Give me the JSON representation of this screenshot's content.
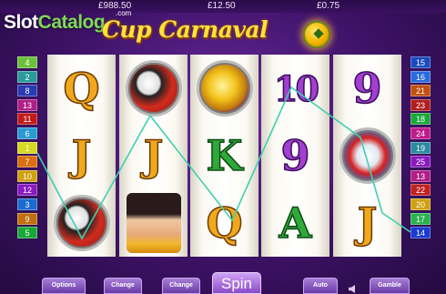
{
  "header": {
    "values": [
      "£988.50",
      "£12.50",
      "£0.75"
    ]
  },
  "watermark": {
    "text_a": "Slot",
    "text_b": "Catalog",
    "suffix": ".com"
  },
  "logo": {
    "text": "Cup Carnaval",
    "ball_icon": "football-icon"
  },
  "paylines_left": [
    {
      "n": "4",
      "color": "#6bbf3a"
    },
    {
      "n": "2",
      "color": "#2a9a9a"
    },
    {
      "n": "8",
      "color": "#2a3ab0"
    },
    {
      "n": "13",
      "color": "#b01e86"
    },
    {
      "n": "11",
      "color": "#c21a1a"
    },
    {
      "n": "6",
      "color": "#2a9ad0"
    },
    {
      "n": "1",
      "color": "#d8d820"
    },
    {
      "n": "7",
      "color": "#d87010"
    },
    {
      "n": "10",
      "color": "#d0a010"
    },
    {
      "n": "12",
      "color": "#8a1ac0"
    },
    {
      "n": "3",
      "color": "#1a6ad0"
    },
    {
      "n": "9",
      "color": "#c07010"
    },
    {
      "n": "5",
      "color": "#1aa83a"
    }
  ],
  "paylines_right": [
    {
      "n": "15",
      "color": "#1a4ac0"
    },
    {
      "n": "16",
      "color": "#2a6ae0"
    },
    {
      "n": "21",
      "color": "#c05010"
    },
    {
      "n": "23",
      "color": "#b01e1e"
    },
    {
      "n": "18",
      "color": "#1aa83a"
    },
    {
      "n": "24",
      "color": "#c01a8a"
    },
    {
      "n": "19",
      "color": "#2a8aa0"
    },
    {
      "n": "25",
      "color": "#8a1ac0"
    },
    {
      "n": "13",
      "color": "#b01e86"
    },
    {
      "n": "22",
      "color": "#c02020"
    },
    {
      "n": "20",
      "color": "#d0a010"
    },
    {
      "n": "17",
      "color": "#2ab050"
    },
    {
      "n": "14",
      "color": "#1a3ad0"
    }
  ],
  "reels": [
    [
      {
        "kind": "letter",
        "text": "Q",
        "style": "g-gold",
        "name": "symbol-q"
      },
      {
        "kind": "letter",
        "text": "J",
        "style": "g-gold",
        "name": "symbol-j"
      },
      {
        "kind": "pic",
        "icon": "football-boots-icon",
        "style": "sym-boots"
      }
    ],
    [
      {
        "kind": "pic",
        "icon": "football-boots-icon",
        "style": "sym-boots"
      },
      {
        "kind": "letter",
        "text": "J",
        "style": "g-gold",
        "name": "symbol-j"
      },
      {
        "kind": "pic",
        "icon": "carnival-dancer-icon",
        "style": "sym-lady"
      }
    ],
    [
      {
        "kind": "pic",
        "icon": "vuvuzela-horn-icon",
        "style": "sym-horn"
      },
      {
        "kind": "letter",
        "text": "K",
        "style": "g-green",
        "name": "symbol-k"
      },
      {
        "kind": "letter",
        "text": "Q",
        "style": "g-gold",
        "name": "symbol-q"
      }
    ],
    [
      {
        "kind": "letter",
        "text": "10",
        "style": "g-purple g-ten",
        "name": "symbol-10"
      },
      {
        "kind": "letter",
        "text": "9",
        "style": "g-purple",
        "name": "symbol-9"
      },
      {
        "kind": "letter",
        "text": "A",
        "style": "g-green",
        "name": "symbol-a"
      }
    ],
    [
      {
        "kind": "letter",
        "text": "9",
        "style": "g-purple",
        "name": "symbol-9"
      },
      {
        "kind": "pic",
        "icon": "football-shoe-icon",
        "style": "sym-shoe"
      },
      {
        "kind": "letter",
        "text": "J",
        "style": "g-gold",
        "name": "symbol-j"
      }
    ]
  ],
  "controls": {
    "options": "Options",
    "change_lines": "Change",
    "change_bet": "Change",
    "spin": "Spin",
    "auto": "Auto",
    "gamble": "Gamble",
    "sound_icon": "speaker-icon"
  },
  "colors": {
    "payline": "#3ed0b0",
    "logo_gold": "#ffe23a"
  }
}
